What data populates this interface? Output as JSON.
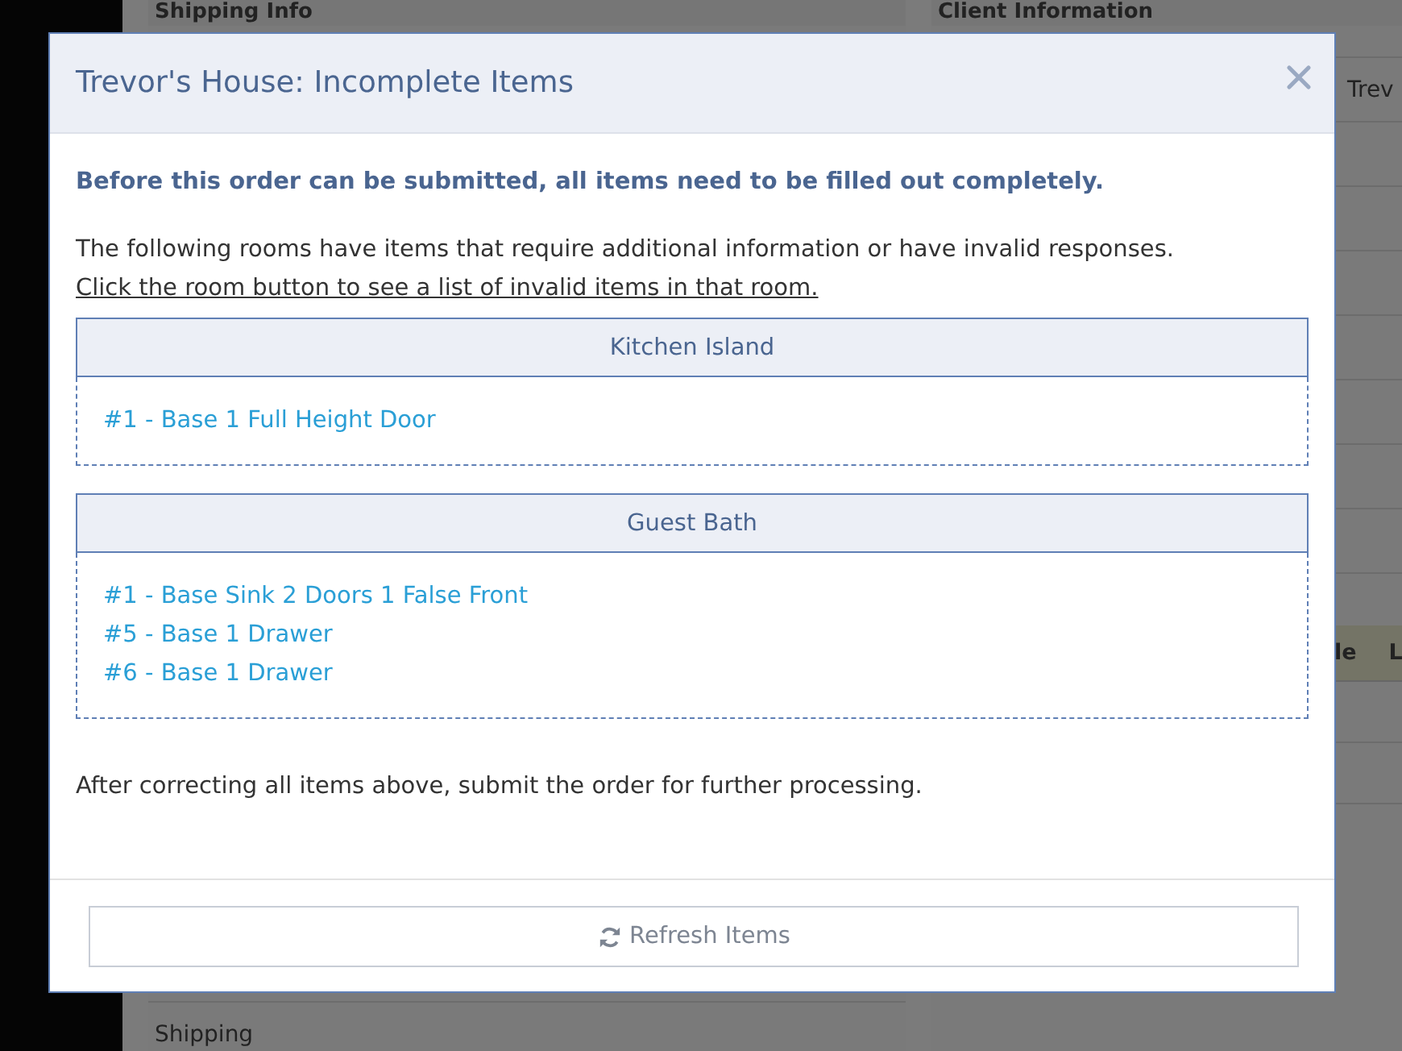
{
  "background": {
    "left_panel": {
      "title": "Shipping Info",
      "row": "Shipping"
    },
    "right_panel": {
      "title": "Client Information",
      "field_value": "Trev",
      "table_headers": [
        "le",
        "L"
      ]
    }
  },
  "dialog": {
    "title": "Trevor's House: Incomplete Items",
    "warning": "Before this order can be submitted, all items need to be filled out completely.",
    "intro": "The following rooms have items that require additional information or have invalid responses.",
    "instruction": "Click the room button to see a list of invalid items in that room.",
    "rooms": [
      {
        "name": "Kitchen Island",
        "items": [
          "#1 - Base 1 Full Height Door"
        ]
      },
      {
        "name": "Guest Bath",
        "items": [
          "#1 - Base Sink 2 Doors 1 False Front",
          "#5 - Base 1 Drawer",
          "#6 - Base 1 Drawer"
        ]
      }
    ],
    "closing": "After correcting all items above, submit the order for further processing.",
    "refresh_button": "Refresh Items"
  }
}
